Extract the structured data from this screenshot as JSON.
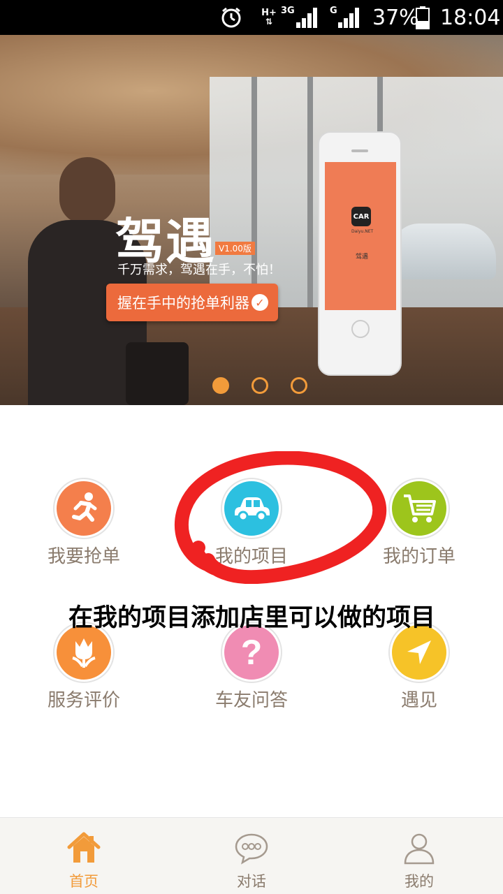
{
  "status_bar": {
    "icons": [
      "alarm-icon",
      "hplus-icon",
      "3g-signal-icon",
      "g-signal-icon",
      "battery-icon"
    ],
    "network_hplus": "H+",
    "network_3g": "3G",
    "network_g": "G",
    "battery_percent": "37%",
    "time": "18:04"
  },
  "banner": {
    "brand_title": "驾遇",
    "version_badge": "V1.00版",
    "slogan": "千万需求，驾遇在手，不怕！",
    "cta_label": "握在手中的抢单利器",
    "phone_logo_text": "CAR",
    "phone_logo_sub": "Daiyu.NET",
    "phone_logo_cn": "驾遇",
    "carousel_active_index": 0,
    "carousel_count": 3
  },
  "features": [
    {
      "label": "我要抢单",
      "icon": "running-person-icon",
      "color": "#f47f4c"
    },
    {
      "label": "我的项目",
      "icon": "car-icon",
      "color": "#2cc0e0"
    },
    {
      "label": "我的订单",
      "icon": "shopping-cart-icon",
      "color": "#9dc51c"
    },
    {
      "label": "服务评价",
      "icon": "tulip-icon",
      "color": "#f7903a"
    },
    {
      "label": "车友问答",
      "icon": "question-icon",
      "color": "#f08cb3"
    },
    {
      "label": "遇见",
      "icon": "navigation-arrow-icon",
      "color": "#f6c328"
    }
  ],
  "annotation": {
    "text": "在我的项目添加店里可以做的项目",
    "ring_color": "#f02020"
  },
  "bottom_nav": [
    {
      "label": "首页",
      "icon": "home-icon",
      "active": true
    },
    {
      "label": "对话",
      "icon": "chat-bubble-icon",
      "active": false
    },
    {
      "label": "我的",
      "icon": "user-profile-icon",
      "active": false
    }
  ],
  "colors": {
    "accent": "#f29b3a",
    "label_text": "#8a7b6d",
    "cta": "#ec6a3c"
  }
}
